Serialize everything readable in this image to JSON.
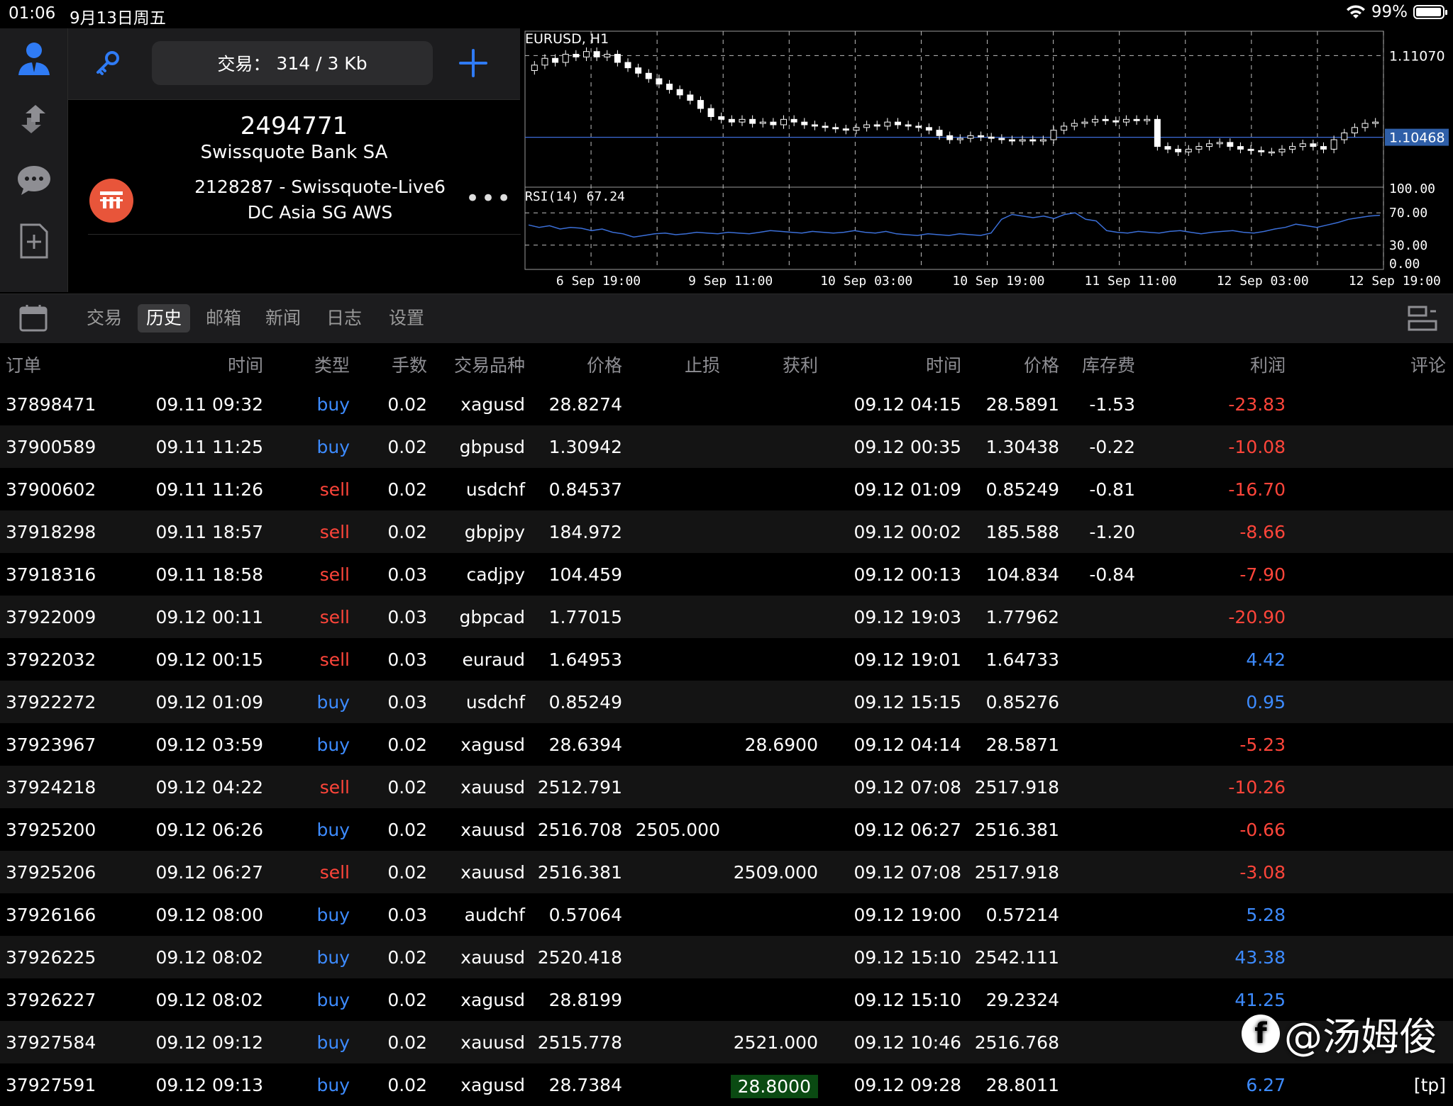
{
  "status": {
    "time": "01:06",
    "date": "9月13日周五",
    "battery": "99%"
  },
  "account": {
    "trade_label": "交易：",
    "trade_value": "314 / 3 Kb",
    "number": "2494771",
    "bank": "Swissquote Bank SA",
    "server_line1": "2128287 - Swissquote-Live6",
    "server_line2": "DC Asia SG AWS"
  },
  "chart_data": {
    "type": "candlestick",
    "title": "EURUSD, H1",
    "price_ticks": [
      "1.11070"
    ],
    "current_price": "1.10468",
    "indicator_label": "RSI(14) 67.24",
    "rsi_ticks": [
      "100.00",
      "70.00",
      "30.00",
      "0.00"
    ],
    "x_ticks": [
      "6 Sep 19:00",
      "9 Sep 11:00",
      "10 Sep 03:00",
      "10 Sep 19:00",
      "11 Sep 11:00",
      "12 Sep 03:00",
      "12 Sep 19:00"
    ],
    "ylim": [
      1.101,
      1.1125
    ],
    "close": [
      1.11,
      1.1105,
      1.1102,
      1.1108,
      1.1106,
      1.111,
      1.1106,
      1.1108,
      1.1102,
      1.1098,
      1.1094,
      1.109,
      1.1086,
      1.1082,
      1.1078,
      1.1074,
      1.1068,
      1.1062,
      1.106,
      1.1058,
      1.106,
      1.1057,
      1.1058,
      1.1056,
      1.106,
      1.1058,
      1.1056,
      1.1055,
      1.1054,
      1.1053,
      1.1052,
      1.1054,
      1.1056,
      1.1055,
      1.1058,
      1.1056,
      1.1055,
      1.1054,
      1.1052,
      1.1048,
      1.1045,
      1.1046,
      1.1048,
      1.1047,
      1.1046,
      1.1045,
      1.1044,
      1.1045,
      1.1044,
      1.1045,
      1.1052,
      1.1055,
      1.1057,
      1.1058,
      1.106,
      1.1059,
      1.1058,
      1.106,
      1.1059,
      1.106,
      1.104,
      1.1038,
      1.1036,
      1.1038,
      1.104,
      1.1042,
      1.1043,
      1.104,
      1.1038,
      1.1037,
      1.1036,
      1.1036,
      1.1038,
      1.104,
      1.1042,
      1.104,
      1.1038,
      1.1045,
      1.105,
      1.1054,
      1.1057,
      1.1058
    ],
    "rsi": [
      55,
      52,
      54,
      50,
      52,
      51,
      48,
      50,
      46,
      44,
      40,
      42,
      44,
      45,
      43,
      44,
      46,
      45,
      44,
      46,
      45,
      44,
      46,
      48,
      47,
      46,
      45,
      47,
      46,
      45,
      46,
      48,
      46,
      45,
      47,
      44,
      43,
      42,
      44,
      43,
      42,
      44,
      43,
      42,
      45,
      62,
      68,
      66,
      64,
      66,
      63,
      68,
      70,
      62,
      60,
      48,
      46,
      45,
      47,
      46,
      45,
      47,
      48,
      46,
      44,
      46,
      47,
      48,
      46,
      45,
      47,
      50,
      52,
      56,
      54,
      52,
      55,
      58,
      62,
      64,
      66,
      67
    ]
  },
  "tabs": [
    "交易",
    "历史",
    "邮箱",
    "新闻",
    "日志",
    "设置"
  ],
  "active_tab": 1,
  "columns": {
    "order": "订单",
    "open_time": "时间",
    "type": "类型",
    "lots": "手数",
    "symbol": "交易品种",
    "open_price": "价格",
    "sl": "止损",
    "tp": "获利",
    "close_time": "时间",
    "close_price": "价格",
    "swap": "库存费",
    "profit": "利润",
    "comment": "评论"
  },
  "rows": [
    {
      "order": "37898471",
      "open_time": "09.11 09:32",
      "type": "buy",
      "lots": "0.02",
      "symbol": "xagusd",
      "open_price": "28.8274",
      "sl": "",
      "tp": "",
      "close_time": "09.12 04:15",
      "close_price": "28.5891",
      "swap": "-1.53",
      "profit": "-23.83",
      "comment": ""
    },
    {
      "order": "37900589",
      "open_time": "09.11 11:25",
      "type": "buy",
      "lots": "0.02",
      "symbol": "gbpusd",
      "open_price": "1.30942",
      "sl": "",
      "tp": "",
      "close_time": "09.12 00:35",
      "close_price": "1.30438",
      "swap": "-0.22",
      "profit": "-10.08",
      "comment": ""
    },
    {
      "order": "37900602",
      "open_time": "09.11 11:26",
      "type": "sell",
      "lots": "0.02",
      "symbol": "usdchf",
      "open_price": "0.84537",
      "sl": "",
      "tp": "",
      "close_time": "09.12 01:09",
      "close_price": "0.85249",
      "swap": "-0.81",
      "profit": "-16.70",
      "comment": ""
    },
    {
      "order": "37918298",
      "open_time": "09.11 18:57",
      "type": "sell",
      "lots": "0.02",
      "symbol": "gbpjpy",
      "open_price": "184.972",
      "sl": "",
      "tp": "",
      "close_time": "09.12 00:02",
      "close_price": "185.588",
      "swap": "-1.20",
      "profit": "-8.66",
      "comment": ""
    },
    {
      "order": "37918316",
      "open_time": "09.11 18:58",
      "type": "sell",
      "lots": "0.03",
      "symbol": "cadjpy",
      "open_price": "104.459",
      "sl": "",
      "tp": "",
      "close_time": "09.12 00:13",
      "close_price": "104.834",
      "swap": "-0.84",
      "profit": "-7.90",
      "comment": ""
    },
    {
      "order": "37922009",
      "open_time": "09.12 00:11",
      "type": "sell",
      "lots": "0.03",
      "symbol": "gbpcad",
      "open_price": "1.77015",
      "sl": "",
      "tp": "",
      "close_time": "09.12 19:03",
      "close_price": "1.77962",
      "swap": "",
      "profit": "-20.90",
      "comment": ""
    },
    {
      "order": "37922032",
      "open_time": "09.12 00:15",
      "type": "sell",
      "lots": "0.03",
      "symbol": "euraud",
      "open_price": "1.64953",
      "sl": "",
      "tp": "",
      "close_time": "09.12 19:01",
      "close_price": "1.64733",
      "swap": "",
      "profit": "4.42",
      "comment": ""
    },
    {
      "order": "37922272",
      "open_time": "09.12 01:09",
      "type": "buy",
      "lots": "0.03",
      "symbol": "usdchf",
      "open_price": "0.85249",
      "sl": "",
      "tp": "",
      "close_time": "09.12 15:15",
      "close_price": "0.85276",
      "swap": "",
      "profit": "0.95",
      "comment": ""
    },
    {
      "order": "37923967",
      "open_time": "09.12 03:59",
      "type": "buy",
      "lots": "0.02",
      "symbol": "xagusd",
      "open_price": "28.6394",
      "sl": "",
      "tp": "28.6900",
      "close_time": "09.12 04:14",
      "close_price": "28.5871",
      "swap": "",
      "profit": "-5.23",
      "comment": ""
    },
    {
      "order": "37924218",
      "open_time": "09.12 04:22",
      "type": "sell",
      "lots": "0.02",
      "symbol": "xauusd",
      "open_price": "2512.791",
      "sl": "",
      "tp": "",
      "close_time": "09.12 07:08",
      "close_price": "2517.918",
      "swap": "",
      "profit": "-10.26",
      "comment": ""
    },
    {
      "order": "37925200",
      "open_time": "09.12 06:26",
      "type": "buy",
      "lots": "0.02",
      "symbol": "xauusd",
      "open_price": "2516.708",
      "sl": "2505.000",
      "tp": "",
      "close_time": "09.12 06:27",
      "close_price": "2516.381",
      "swap": "",
      "profit": "-0.66",
      "comment": ""
    },
    {
      "order": "37925206",
      "open_time": "09.12 06:27",
      "type": "sell",
      "lots": "0.02",
      "symbol": "xauusd",
      "open_price": "2516.381",
      "sl": "",
      "tp": "2509.000",
      "close_time": "09.12 07:08",
      "close_price": "2517.918",
      "swap": "",
      "profit": "-3.08",
      "comment": ""
    },
    {
      "order": "37926166",
      "open_time": "09.12 08:00",
      "type": "buy",
      "lots": "0.03",
      "symbol": "audchf",
      "open_price": "0.57064",
      "sl": "",
      "tp": "",
      "close_time": "09.12 19:00",
      "close_price": "0.57214",
      "swap": "",
      "profit": "5.28",
      "comment": ""
    },
    {
      "order": "37926225",
      "open_time": "09.12 08:02",
      "type": "buy",
      "lots": "0.02",
      "symbol": "xauusd",
      "open_price": "2520.418",
      "sl": "",
      "tp": "",
      "close_time": "09.12 15:10",
      "close_price": "2542.111",
      "swap": "",
      "profit": "43.38",
      "comment": ""
    },
    {
      "order": "37926227",
      "open_time": "09.12 08:02",
      "type": "buy",
      "lots": "0.02",
      "symbol": "xagusd",
      "open_price": "28.8199",
      "sl": "",
      "tp": "",
      "close_time": "09.12 15:10",
      "close_price": "29.2324",
      "swap": "",
      "profit": "41.25",
      "comment": ""
    },
    {
      "order": "37927584",
      "open_time": "09.12 09:12",
      "type": "buy",
      "lots": "0.02",
      "symbol": "xauusd",
      "open_price": "2515.778",
      "sl": "",
      "tp": "2521.000",
      "close_time": "09.12 10:46",
      "close_price": "2516.768",
      "swap": "",
      "profit": "",
      "comment": ""
    },
    {
      "order": "37927591",
      "open_time": "09.12 09:13",
      "type": "buy",
      "lots": "0.02",
      "symbol": "xagusd",
      "open_price": "28.7384",
      "sl": "",
      "tp": "28.8000",
      "close_time": "09.12 09:28",
      "close_price": "28.8011",
      "swap": "",
      "profit": "6.27",
      "comment": "[tp]"
    }
  ],
  "watermark": "@汤姆俊",
  "colors": {
    "buy": "#3d8bff",
    "sell": "#ff453a",
    "accent": "#2f7bf5"
  }
}
